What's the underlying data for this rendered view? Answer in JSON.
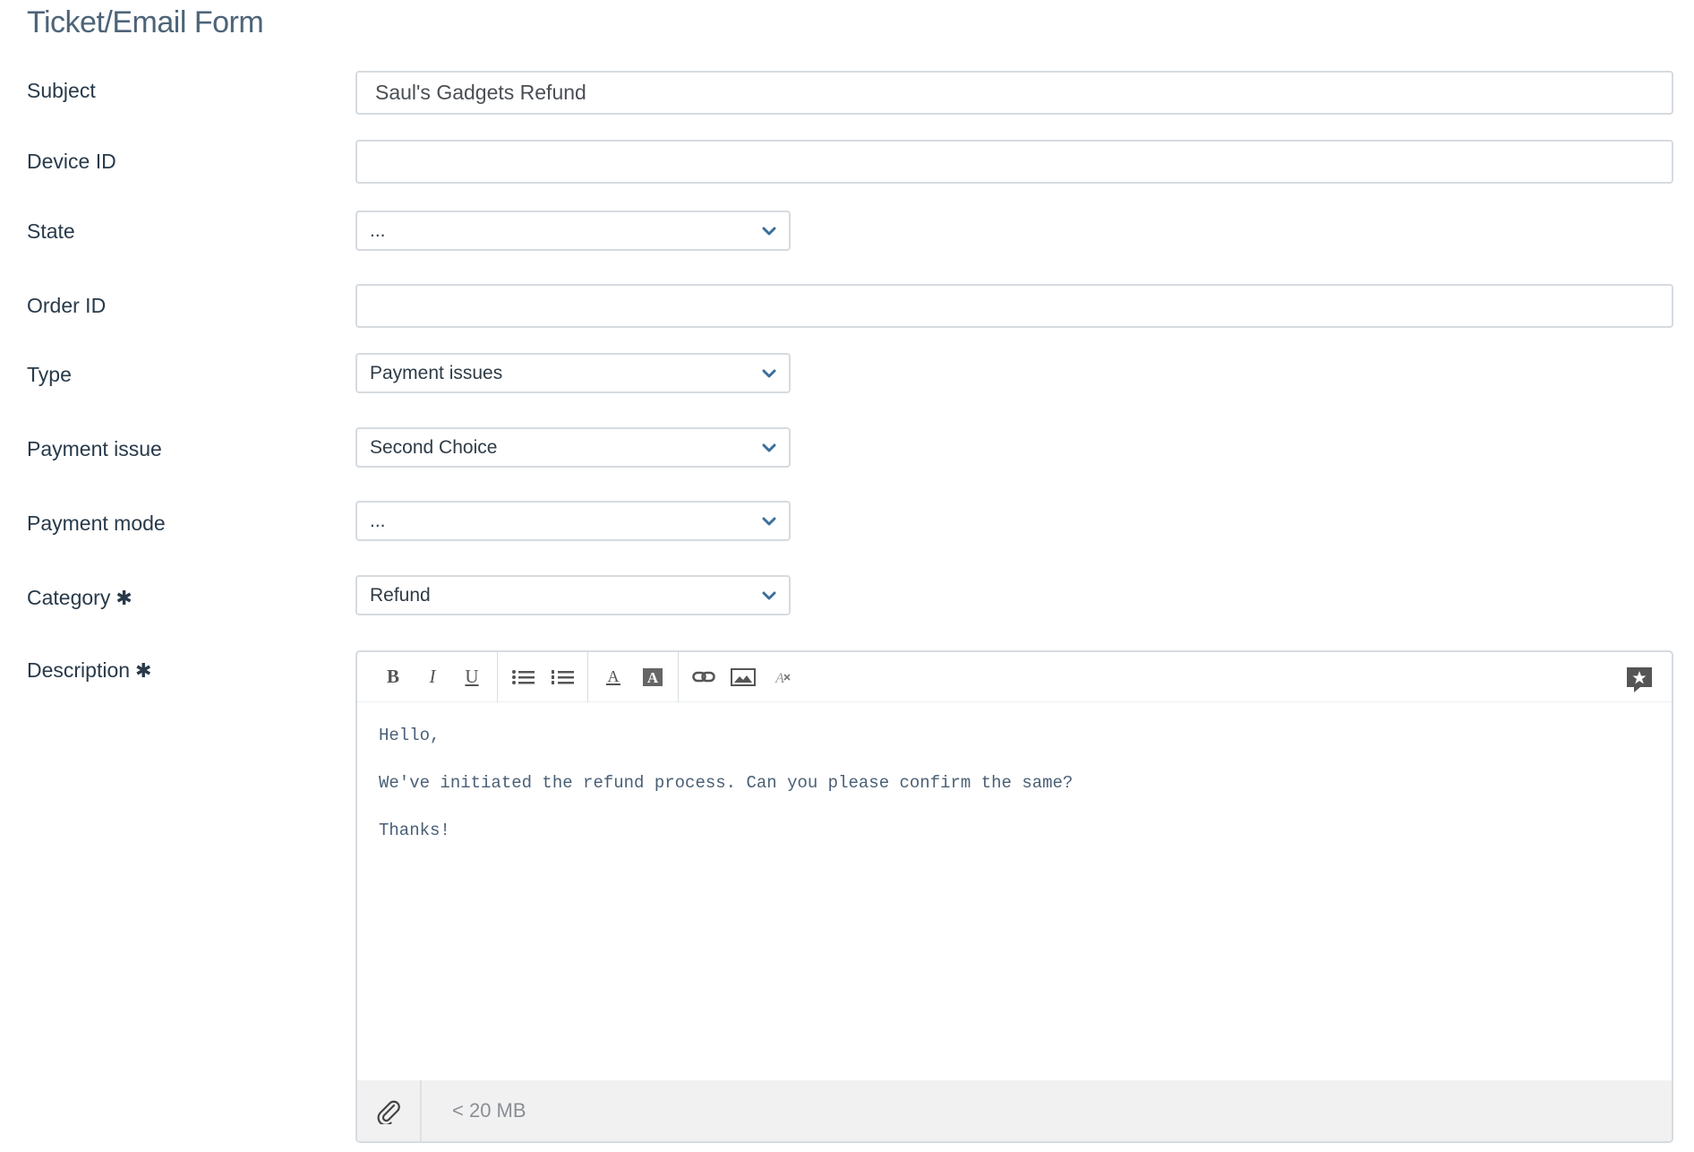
{
  "form": {
    "title": "Ticket/Email Form",
    "fields": {
      "subject": {
        "label": "Subject",
        "value": "Saul's Gadgets Refund"
      },
      "device_id": {
        "label": "Device ID",
        "value": ""
      },
      "state": {
        "label": "State",
        "value": "..."
      },
      "order_id": {
        "label": "Order ID",
        "value": ""
      },
      "type": {
        "label": "Type",
        "value": "Payment issues"
      },
      "payment_issue": {
        "label": "Payment issue",
        "value": "Second Choice"
      },
      "payment_mode": {
        "label": "Payment mode",
        "value": "..."
      },
      "category": {
        "label": "Category",
        "required_mark": "✱",
        "value": "Refund"
      },
      "description": {
        "label": "Description",
        "required_mark": "✱",
        "lines": [
          "Hello,",
          "We've initiated the refund process. Can you please confirm the same?",
          "Thanks!"
        ],
        "toolbar": {
          "bold": "B",
          "italic": "I",
          "underline": "U",
          "icons": [
            "bulleted-list-icon",
            "numbered-list-icon",
            "text-color-icon",
            "background-color-icon",
            "link-icon",
            "image-icon",
            "clear-format-icon",
            "macro-icon"
          ]
        },
        "attachment_limit": "< 20 MB"
      }
    }
  }
}
